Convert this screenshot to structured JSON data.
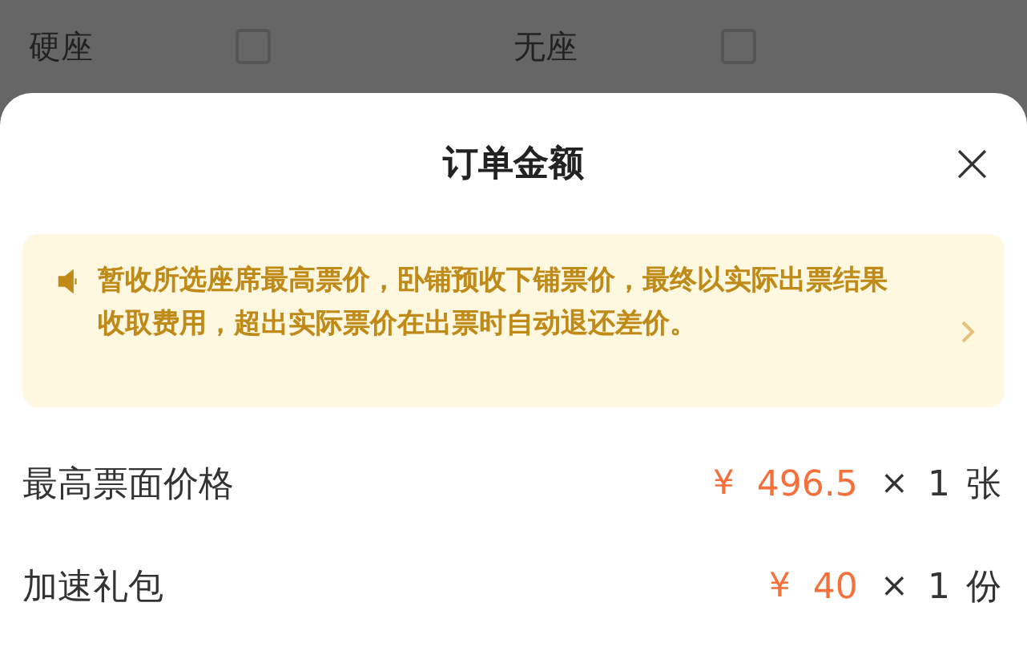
{
  "seat_options": [
    {
      "label": "硬座",
      "checked": false
    },
    {
      "label": "无座",
      "checked": false
    }
  ],
  "sheet": {
    "title": "订单金额",
    "close": "×",
    "notice": "暂收所选座席最高票价，卧铺预收下铺票价，最终以实际出票结果收取费用，超出实际票价在出票时自动退还差价。",
    "items": [
      {
        "label": "最高票面价格",
        "currency": "¥",
        "amount": "496.5",
        "times": "×",
        "quantity": "1",
        "unit": "张"
      },
      {
        "label": "加速礼包",
        "currency": "¥",
        "amount": "40",
        "times": "×",
        "quantity": "1",
        "unit": "份"
      }
    ]
  }
}
